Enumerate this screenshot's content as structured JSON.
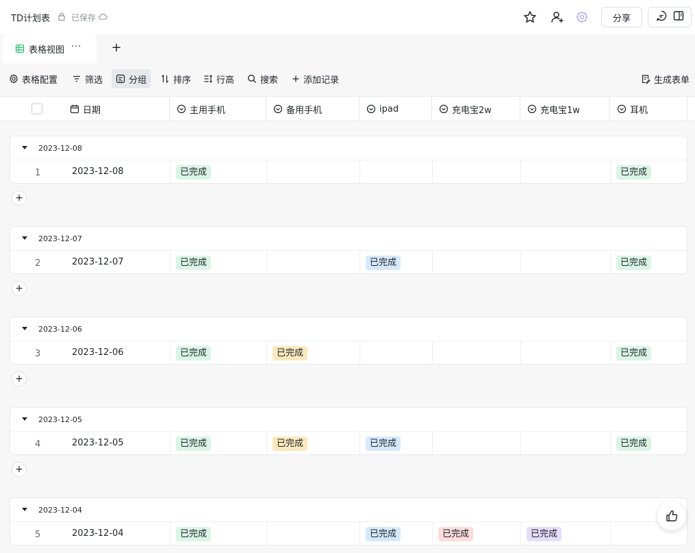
{
  "doc": {
    "title": "TD计划表",
    "saved": "已保存"
  },
  "header_actions": {
    "share_label": "分享"
  },
  "tabs": {
    "active_label": "表格视图",
    "more": "···",
    "add": "+"
  },
  "toolbar": {
    "config": "表格配置",
    "filter": "筛选",
    "group": "分组",
    "sort": "排序",
    "row_height": "行高",
    "search": "搜索",
    "add_record": "添加记录",
    "gen_form": "生成表单"
  },
  "columns": [
    "日期",
    "主用手机",
    "备用手机",
    "ipad",
    "充电宝2w",
    "充电宝1w",
    "耳机"
  ],
  "status_colors": {
    "green": "#d9f5e6",
    "yellow": "#fbe9bd",
    "blue": "#d6e8fc",
    "red": "#fcdcdc",
    "purple": "#e6dcfb"
  },
  "groups": [
    {
      "label": "2023-12-08",
      "row": {
        "num": "1",
        "date": "2023-12-08",
        "main": "已完成",
        "backup": "",
        "ipad": "",
        "pb2w": "",
        "pb1w": "",
        "earphone": "已完成"
      }
    },
    {
      "label": "2023-12-07",
      "row": {
        "num": "2",
        "date": "2023-12-07",
        "main": "已完成",
        "backup": "",
        "ipad": "已完成",
        "pb2w": "",
        "pb1w": "",
        "earphone": "已完成"
      }
    },
    {
      "label": "2023-12-06",
      "row": {
        "num": "3",
        "date": "2023-12-06",
        "main": "已完成",
        "backup": "已完成",
        "ipad": "",
        "pb2w": "",
        "pb1w": "",
        "earphone": "已完成"
      }
    },
    {
      "label": "2023-12-05",
      "row": {
        "num": "4",
        "date": "2023-12-05",
        "main": "已完成",
        "backup": "已完成",
        "ipad": "已完成",
        "pb2w": "",
        "pb1w": "",
        "earphone": "已完成"
      }
    },
    {
      "label": "2023-12-04",
      "row": {
        "num": "5",
        "date": "2023-12-04",
        "main": "已完成",
        "backup": "",
        "ipad": "已完成",
        "pb2w": "已完成",
        "pb1w": "已完成",
        "earphone": ""
      }
    }
  ],
  "add_row_symbol": "+"
}
